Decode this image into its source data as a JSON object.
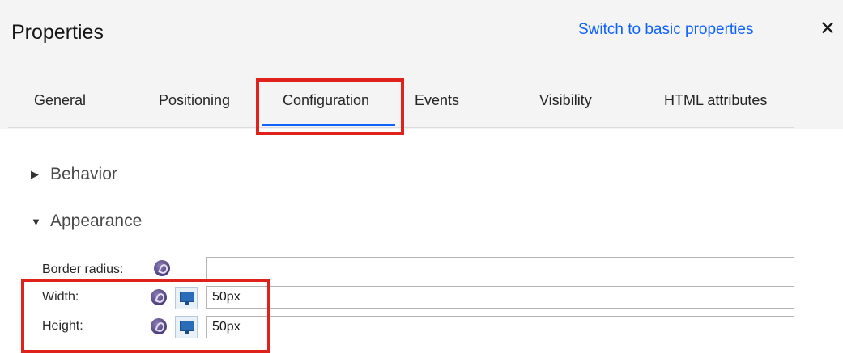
{
  "header": {
    "title": "Properties",
    "switch_link": "Switch to basic properties",
    "close_glyph": "✕"
  },
  "tabs": [
    {
      "label": "General",
      "active": false
    },
    {
      "label": "Positioning",
      "active": false
    },
    {
      "label": "Configuration",
      "active": true
    },
    {
      "label": "Events",
      "active": false
    },
    {
      "label": "Visibility",
      "active": false
    },
    {
      "label": "HTML attributes",
      "active": false
    }
  ],
  "sections": {
    "behavior": {
      "label": "Behavior",
      "expanded": false
    },
    "appearance": {
      "label": "Appearance",
      "expanded": true
    }
  },
  "fields": {
    "border_radius": {
      "label": "Border radius:",
      "value": ""
    },
    "width": {
      "label": "Width:",
      "value": "50px"
    },
    "height": {
      "label": "Height:",
      "value": "50px"
    }
  },
  "icons": {
    "bind": "variable-binding-icon",
    "screen": "screen-size-icon",
    "close": "close-icon",
    "expand": "triangle-right-icon",
    "collapse": "triangle-down-icon"
  },
  "colors": {
    "accent": "#0f62fe",
    "highlight": "#e0221c",
    "panel_bg": "#f4f4f4"
  }
}
